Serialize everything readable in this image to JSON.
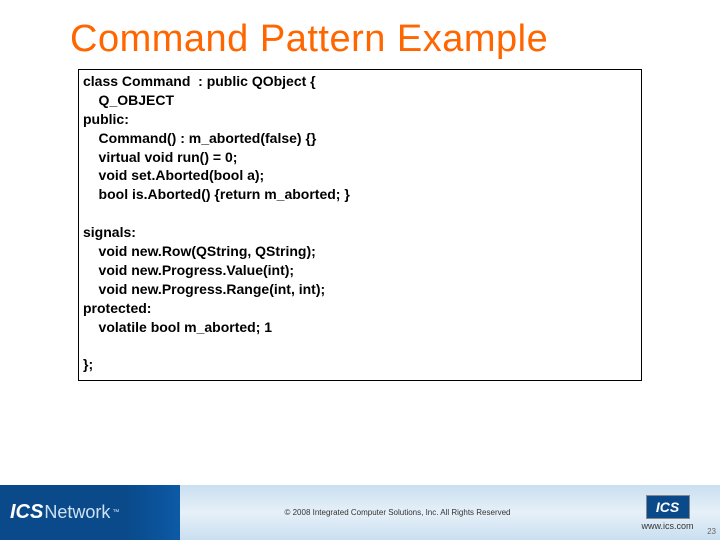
{
  "slide": {
    "title": "Command Pattern Example"
  },
  "code": {
    "line1": "class Command  : public QObject {",
    "line2": "    Q_OBJECT",
    "line3": "public:",
    "line4": "    Command() : m_aborted(false) {}",
    "line5": "    virtual void run() = 0;",
    "line6": "    void set.Aborted(bool a);",
    "line7": "    bool is.Aborted() {return m_aborted; }",
    "line8": "",
    "line9": "signals:",
    "line10": "    void new.Row(QString, QString);",
    "line11": "    void new.Progress.Value(int);",
    "line12": "    void new.Progress.Range(int, int);",
    "line13": "protected:",
    "line14": "    volatile bool m_aborted; 1",
    "line15": "",
    "line16": "};"
  },
  "footer": {
    "logo_text_ics": "ICS",
    "logo_text_network": "Network",
    "logo_tm": "™",
    "copyright": "© 2008 Integrated Computer Solutions, Inc. All Rights Reserved",
    "small_logo": "ICS",
    "url": "www.ics.com"
  },
  "page_number": "23"
}
